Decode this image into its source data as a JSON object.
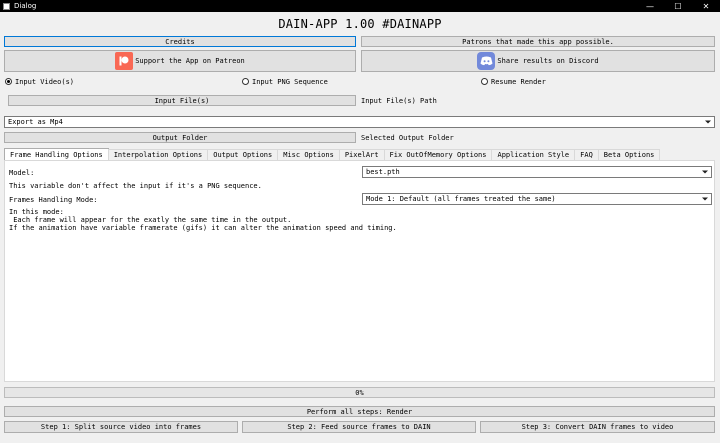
{
  "window": {
    "title": "Dialog",
    "minimize": "—",
    "maximize": "☐",
    "close": "✕"
  },
  "app_title": "DAIN-APP 1.00 #DAINAPP",
  "buttons": {
    "credits": "Credits",
    "patrons": "Patrons that made this app possible.",
    "patreon": "Support the App on Patreon",
    "discord": "Share results on Discord",
    "input_files": "Input File(s)",
    "output_folder": "Output Folder",
    "perform_all": "Perform all steps: Render",
    "step1": "Step 1: Split source video into frames",
    "step2": "Step 2: Feed source frames to DAIN",
    "step3": "Step 3: Convert DAIN frames to video"
  },
  "input_mode": {
    "options": [
      {
        "label": "Input Video(s)",
        "selected": true
      },
      {
        "label": "Input PNG Sequence",
        "selected": false
      },
      {
        "label": "Resume Render",
        "selected": false
      }
    ]
  },
  "labels": {
    "input_path": "Input File(s) Path",
    "output_path": "Selected Output Folder"
  },
  "export": {
    "selected": "Export as Mp4"
  },
  "tabs": [
    {
      "label": "Frame Handling Options",
      "active": true
    },
    {
      "label": "Interpolation Options",
      "active": false
    },
    {
      "label": "Output Options",
      "active": false
    },
    {
      "label": "Misc Options",
      "active": false
    },
    {
      "label": "PixelArt",
      "active": false
    },
    {
      "label": "Fix OutOfMemory Options",
      "active": false
    },
    {
      "label": "Application Style",
      "active": false
    },
    {
      "label": "FAQ",
      "active": false
    },
    {
      "label": "Beta Options",
      "active": false
    }
  ],
  "frame_tab": {
    "model_label": "Model:",
    "model_value": "best.pth",
    "model_note": "This variable don't affect the input if it's a PNG sequence.",
    "mode_label": "Frames Handling Mode:",
    "mode_value": "Mode 1: Default (all frames treated the same)",
    "desc_line1": "In this mode:",
    "desc_line2": " Each frame will appear for the exatly the same time in the output.",
    "desc_line3": "If the animation have variable framerate (gifs) it can alter the animation speed and timing."
  },
  "progress": {
    "text": "0%",
    "value": 0
  },
  "colors": {
    "accent": "#0078d7",
    "patreon": "#f96854",
    "discord": "#7289da",
    "progress": "#06b025"
  },
  "icons": {
    "patreon": "patreon-icon",
    "discord": "discord-icon"
  }
}
